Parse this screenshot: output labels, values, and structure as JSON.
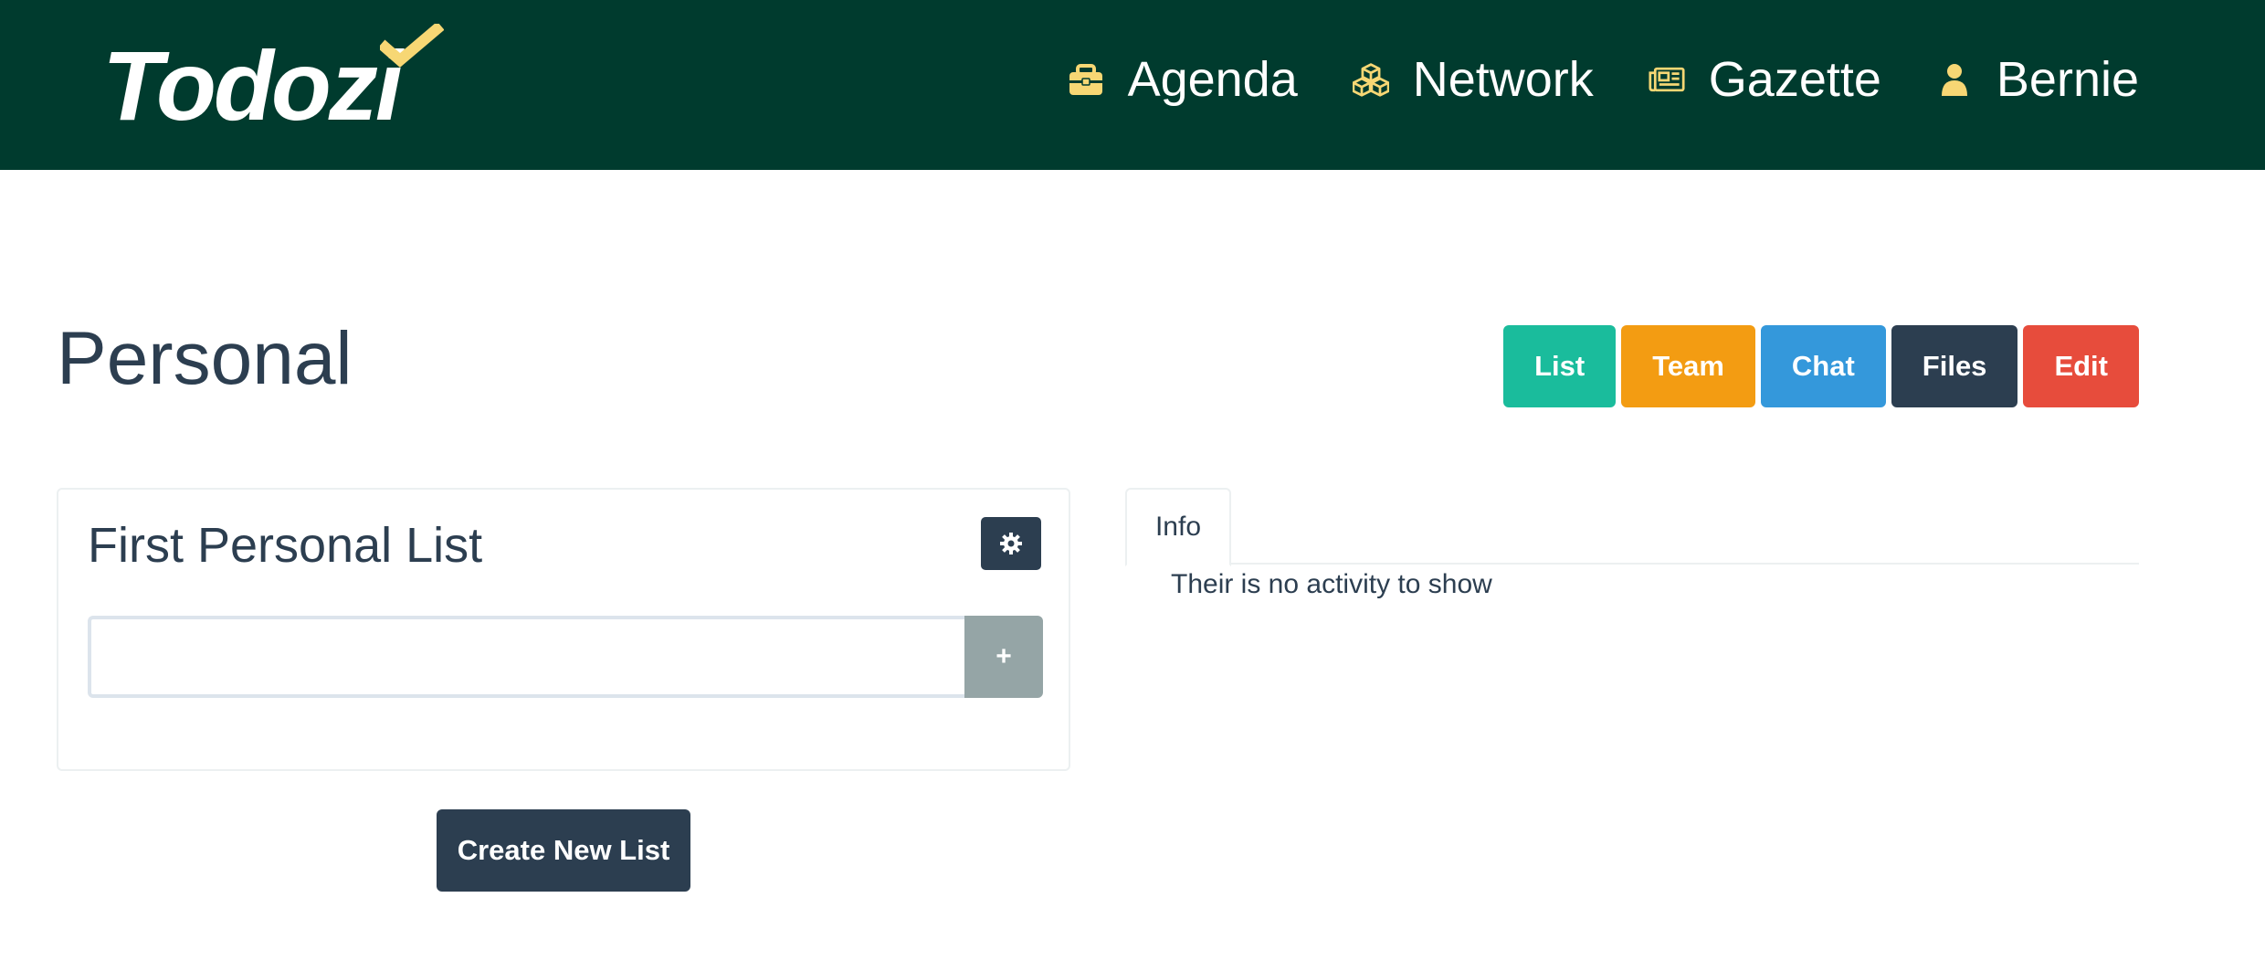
{
  "header": {
    "logo_text": "Todozi",
    "nav": [
      {
        "label": "Agenda",
        "icon": "briefcase-icon"
      },
      {
        "label": "Network",
        "icon": "cubes-icon"
      },
      {
        "label": "Gazette",
        "icon": "newspaper-icon"
      },
      {
        "label": "Bernie",
        "icon": "user-icon"
      }
    ]
  },
  "page": {
    "title": "Personal",
    "actions": [
      {
        "label": "List",
        "color": "#1abc9c"
      },
      {
        "label": "Team",
        "color": "#f39c12"
      },
      {
        "label": "Chat",
        "color": "#3498db"
      },
      {
        "label": "Files",
        "color": "#2c3e50"
      },
      {
        "label": "Edit",
        "color": "#e74c3c"
      }
    ]
  },
  "list_card": {
    "title": "First Personal List",
    "settings_icon": "gear-icon",
    "input_value": "",
    "add_label": "+"
  },
  "create_button": {
    "label": "Create New List"
  },
  "info_panel": {
    "tab_label": "Info",
    "empty_text": "Their is no activity to show"
  },
  "colors": {
    "header_bg": "#003b2e",
    "icon_accent": "#f7d774",
    "text_dark": "#2c3e50",
    "add_button": "#95a5a6"
  }
}
